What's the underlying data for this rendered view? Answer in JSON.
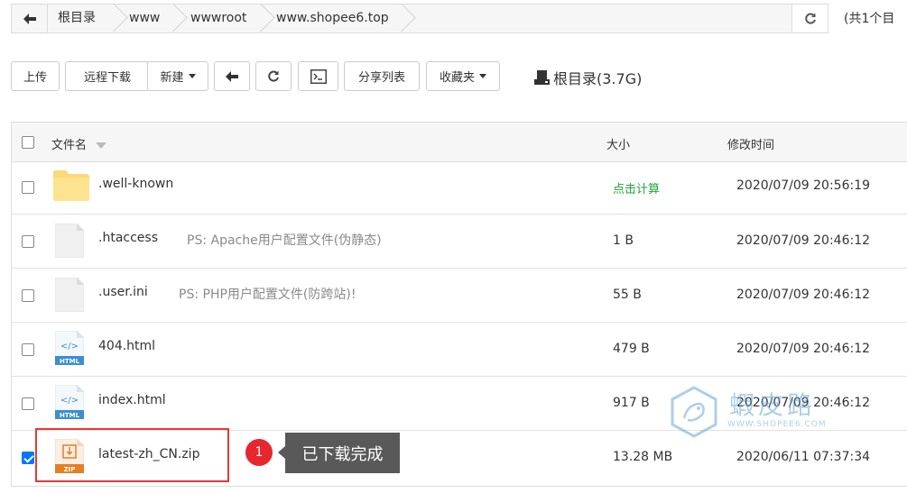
{
  "breadcrumb": {
    "items": [
      "根目录",
      "www",
      "wwwroot",
      "www.shopee6.top"
    ],
    "total": "(共1个目"
  },
  "toolbar": {
    "upload": "上传",
    "remote_download": "远程下载",
    "new": "新建",
    "share_list": "分享列表",
    "favorites": "收藏夹",
    "disk": "根目录(3.7G)"
  },
  "table": {
    "headers": {
      "name": "文件名",
      "size": "大小",
      "modified": "修改时间"
    },
    "rows": [
      {
        "name": ".well-known",
        "note": "",
        "size": "点击计算",
        "time": "2020/07/09 20:56:19",
        "icon": "folder-icon",
        "checked": false
      },
      {
        "name": ".htaccess",
        "note": "PS: Apache用户配置文件(伪静态)",
        "size": "1 B",
        "time": "2020/07/09 20:46:12",
        "icon": "file-icon",
        "checked": false
      },
      {
        "name": ".user.ini",
        "note": "PS: PHP用户配置文件(防跨站)!",
        "size": "55 B",
        "time": "2020/07/09 20:46:12",
        "icon": "file-icon",
        "checked": false
      },
      {
        "name": "404.html",
        "note": "",
        "size": "479 B",
        "time": "2020/07/09 20:46:12",
        "icon": "html-file-icon",
        "checked": false
      },
      {
        "name": "index.html",
        "note": "",
        "size": "917 B",
        "time": "2020/07/09 20:46:12",
        "icon": "html-file-icon",
        "checked": false
      },
      {
        "name": "latest-zh_CN.zip",
        "note": "",
        "size": "13.28 MB",
        "time": "2020/06/11 07:37:34",
        "icon": "zip-file-icon",
        "checked": true
      }
    ]
  },
  "icon_labels": {
    "html": "HTML",
    "zip": "ZIP",
    "code": "</>"
  },
  "annotation": {
    "number": "1",
    "text": "已下载完成"
  },
  "watermark": {
    "text": "蝦皮路",
    "sub": "WWW.SHOPEE6.COM"
  },
  "colors": {
    "accent_green": "#20a53a",
    "highlight_red": "#e53935",
    "checkbox_blue": "#0075ff"
  }
}
